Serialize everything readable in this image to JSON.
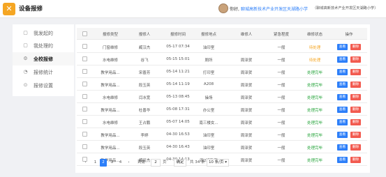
{
  "header": {
    "app_title": "设备报修",
    "greeting": "你好,",
    "school_link": "聊城高新技术产业开发区天湖路小学",
    "school_tag": "（聊城高新技术产业开发区天湖路小学）"
  },
  "sidebar": {
    "items": [
      {
        "label": "我发起的",
        "icon": "▢",
        "icon_name": "document-icon"
      },
      {
        "label": "我处理的",
        "icon": "▢",
        "icon_name": "task-icon"
      },
      {
        "label": "全校报修",
        "icon": "⚙",
        "icon_name": "gear-icon"
      },
      {
        "label": "报修统计",
        "icon": "◔",
        "icon_name": "chart-icon"
      },
      {
        "label": "报修设置",
        "icon": "⊙",
        "icon_name": "settings-icon"
      }
    ]
  },
  "table": {
    "columns": [
      "报修类型",
      "报修人",
      "报修时间",
      "报修地点",
      "维修人",
      "紧急程度",
      "维修状态",
      "操作"
    ],
    "view_label": "查看",
    "delete_label": "删除",
    "rows": [
      {
        "type": "门窗维修",
        "reporter": "臧汉杰",
        "time": "05-17 07:34",
        "location": "油印室",
        "repairer": "",
        "urgency": "一般",
        "status": "待处理",
        "status_kind": "pending"
      },
      {
        "type": "水电维修",
        "reporter": "谷飞",
        "time": "05-15 15:01",
        "location": "厕所",
        "repairer": "周泽贺",
        "urgency": "一般",
        "status": "待处理",
        "status_kind": "pending"
      },
      {
        "type": "教学用品...",
        "reporter": "宋善芳",
        "time": "05-14 11:21",
        "location": "打印室",
        "repairer": "周泽贺",
        "urgency": "一般",
        "status": "处理完毕",
        "status_kind": "done"
      },
      {
        "type": "教学用品...",
        "reporter": "段玉英",
        "time": "05-14 11:19",
        "location": "A208",
        "repairer": "周泽贺",
        "urgency": "一般",
        "status": "处理完毕",
        "status_kind": "done"
      },
      {
        "type": "水电维修",
        "reporter": "闫冰宽",
        "time": "05-13 08:45",
        "location": "操场",
        "repairer": "周泽贺",
        "urgency": "一般",
        "status": "处理完毕",
        "status_kind": "done"
      },
      {
        "type": "教学用品...",
        "reporter": "杜善华",
        "time": "05-08 17:31",
        "location": "办公室",
        "repairer": "周泽贺",
        "urgency": "一般",
        "status": "处理完毕",
        "status_kind": "done"
      },
      {
        "type": "水电维修",
        "reporter": "王占鹏",
        "time": "05-07 14:05",
        "location": "南三楼女...",
        "repairer": "周泽贺",
        "urgency": "一般",
        "status": "处理完毕",
        "status_kind": "done"
      },
      {
        "type": "教学用品...",
        "reporter": "李婷",
        "time": "04-30 16:53",
        "location": "油印室",
        "repairer": "周泽贺",
        "urgency": "一般",
        "status": "处理完毕",
        "status_kind": "done"
      },
      {
        "type": "教学用品...",
        "reporter": "段玉英",
        "time": "04-30 16:43",
        "location": "油印室",
        "repairer": "周泽贺",
        "urgency": "一般",
        "status": "处理完毕",
        "status_kind": "done"
      },
      {
        "type": "教学用品...",
        "reporter": "臧汉杰",
        "time": "04-30 14:13",
        "location": "四2班教室",
        "repairer": "周泽贺",
        "urgency": "一般",
        "status": "处理完毕",
        "status_kind": "done"
      }
    ]
  },
  "pager": {
    "prev": "‹",
    "pages": [
      "1",
      "2",
      "3",
      "4"
    ],
    "current_page": "2",
    "next": "›",
    "goto_prefix": "到第",
    "goto_value": "2",
    "goto_suffix": "页",
    "confirm": "确定",
    "total": "共 34 条",
    "page_size": "10 条/页 ▾"
  },
  "colors": {
    "accent": "#2d7ff9",
    "logo": "#f5a623",
    "pending": "#f5a623",
    "done": "#2aa63f",
    "delete": "#f25a4f"
  }
}
